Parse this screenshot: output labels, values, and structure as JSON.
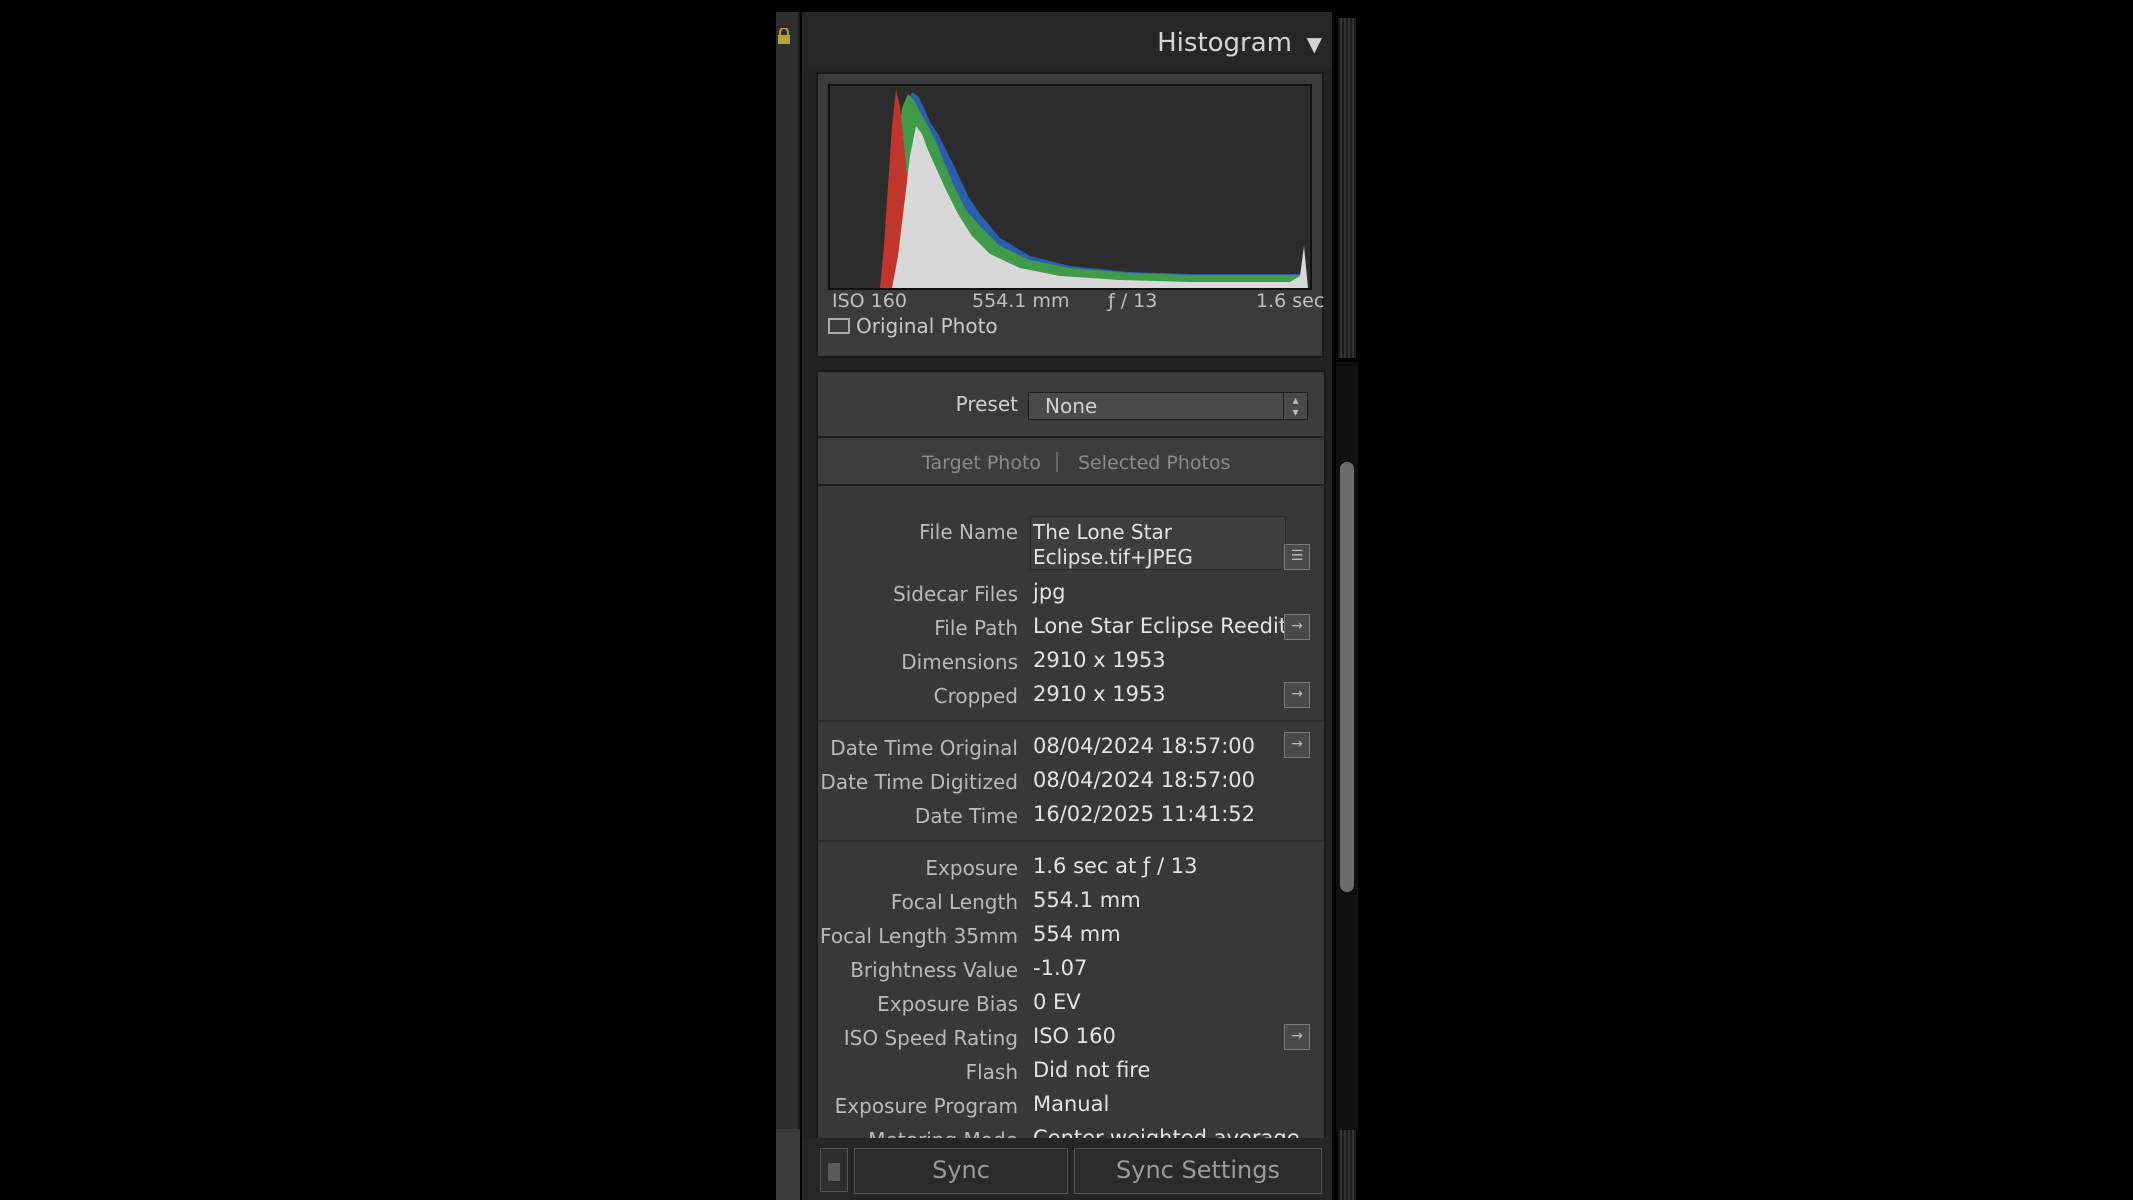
{
  "histogram": {
    "title": "Histogram",
    "info": {
      "iso": "ISO 160",
      "focal": "554.1 mm",
      "aperture": "ƒ / 13",
      "shutter": "1.6 sec"
    },
    "original_photo_label": "Original Photo",
    "colors": {
      "red": "#c2352b",
      "green": "#3f9a4a",
      "blue": "#2a5fb0",
      "white": "#d8d8d8"
    }
  },
  "metadata": {
    "preset_label": "Preset",
    "preset_value": "None",
    "tabs": {
      "target": "Target Photo",
      "selected": "Selected Photos"
    },
    "file_name_label": "File Name",
    "file_name_line1": "The Lone Star",
    "file_name_line2": "Eclipse.tif+JPEG",
    "rows": [
      {
        "label": "Sidecar Files",
        "value": "jpg"
      },
      {
        "label": "File Path",
        "value": "Lone Star Eclipse Reedit"
      },
      {
        "label": "Dimensions",
        "value": "2910 x 1953"
      },
      {
        "label": "Cropped",
        "value": "2910 x 1953"
      },
      {
        "label": "Date Time Original",
        "value": "08/04/2024 18:57:00"
      },
      {
        "label": "Date Time Digitized",
        "value": "08/04/2024 18:57:00"
      },
      {
        "label": "Date Time",
        "value": "16/02/2025 11:41:52"
      },
      {
        "label": "Exposure",
        "value": "1.6 sec at ƒ / 13"
      },
      {
        "label": "Focal Length",
        "value": "554.1 mm"
      },
      {
        "label": "Focal Length 35mm",
        "value": "554 mm"
      },
      {
        "label": "Brightness Value",
        "value": "-1.07"
      },
      {
        "label": "Exposure Bias",
        "value": "0 EV"
      },
      {
        "label": "ISO Speed Rating",
        "value": "ISO 160"
      },
      {
        "label": "Flash",
        "value": "Did not fire"
      },
      {
        "label": "Exposure Program",
        "value": "Manual"
      },
      {
        "label": "Metering Mode",
        "value": "Center-weighted average"
      }
    ]
  },
  "bottom": {
    "sync": "Sync",
    "sync_settings": "Sync Settings"
  }
}
